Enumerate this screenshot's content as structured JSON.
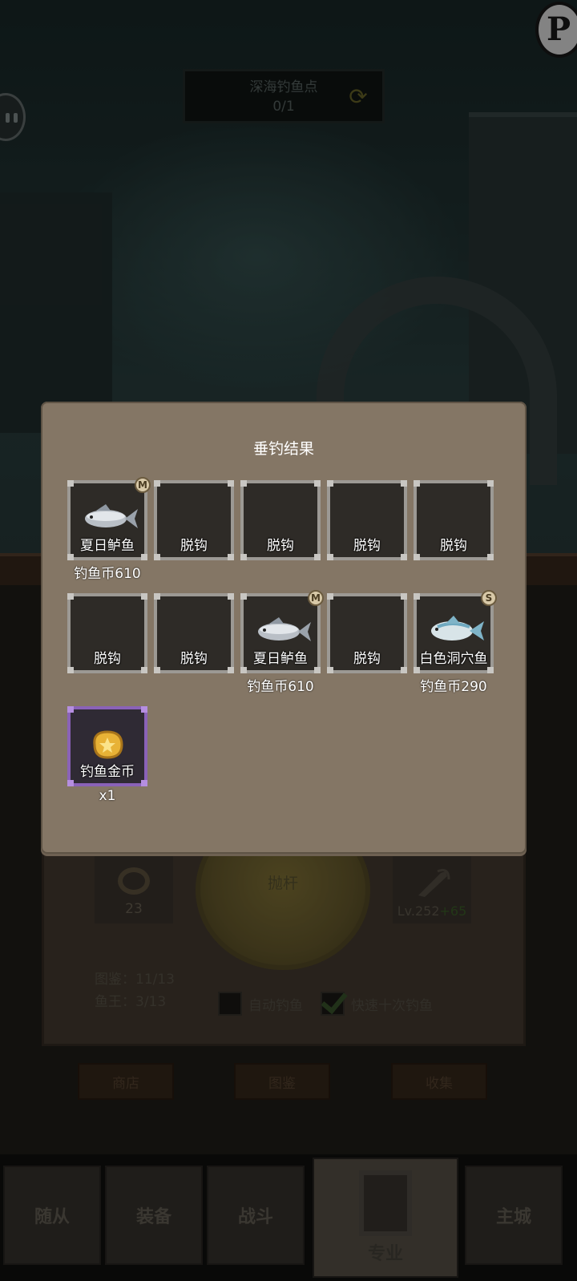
{
  "hud": {
    "spot_name": "深海钓鱼点",
    "spot_progress": "0/1",
    "refresh_icon": "refresh-icon",
    "top_right_badge": "P"
  },
  "fishing_panel": {
    "bait_count": "23",
    "cast_label": "抛杆",
    "rod_level": "Lv.252",
    "rod_bonus": "+65",
    "codex_stat": "图鉴：11/13",
    "fish_king_stat": "鱼王：3/13",
    "auto_fish_label": "自动钓鱼",
    "auto_fish_checked": false,
    "fast_ten_label": "快速十次钓鱼",
    "fast_ten_checked": true
  },
  "wood_buttons": [
    "商店",
    "图鉴",
    "收集"
  ],
  "bottom_nav": {
    "tabs": [
      "随从",
      "装备",
      "战斗",
      "专业",
      "主城"
    ],
    "active": "专业"
  },
  "result_dialog": {
    "title": "垂钓结果",
    "slots": [
      {
        "label": "夏日鲈鱼",
        "sub": "钓鱼币610",
        "rarity": "M",
        "icon": "fish-icon"
      },
      {
        "label": "脱钩",
        "sub": "",
        "rarity": "",
        "icon": ""
      },
      {
        "label": "脱钩",
        "sub": "",
        "rarity": "",
        "icon": ""
      },
      {
        "label": "脱钩",
        "sub": "",
        "rarity": "",
        "icon": ""
      },
      {
        "label": "脱钩",
        "sub": "",
        "rarity": "",
        "icon": ""
      },
      {
        "label": "脱钩",
        "sub": "",
        "rarity": "",
        "icon": ""
      },
      {
        "label": "脱钩",
        "sub": "",
        "rarity": "",
        "icon": ""
      },
      {
        "label": "夏日鲈鱼",
        "sub": "钓鱼币610",
        "rarity": "M",
        "icon": "fish-icon"
      },
      {
        "label": "脱钩",
        "sub": "",
        "rarity": "",
        "icon": ""
      },
      {
        "label": "白色洞穴鱼",
        "sub": "钓鱼币290",
        "rarity": "S",
        "icon": "cave-fish-icon"
      },
      {
        "label": "钓鱼金币",
        "sub": "x1",
        "rarity": "",
        "icon": "gold-coin-icon"
      }
    ]
  }
}
